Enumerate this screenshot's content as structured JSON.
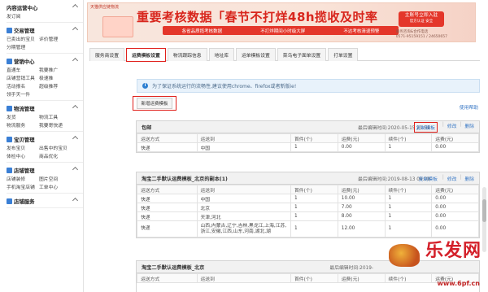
{
  "sidebar": {
    "sections": [
      {
        "title": "内容运营中心",
        "rows": [
          [
            "发订阅"
          ]
        ]
      },
      {
        "title": "交易管理",
        "rows": [
          [
            "已卖出的宝贝",
            "评价管理"
          ],
          [
            "分期管理"
          ]
        ]
      },
      {
        "title": "营销中心",
        "rows": [
          [
            "直通车",
            "我要推广"
          ],
          [
            "店铺营销工具",
            "极速推"
          ],
          [
            "活动报名",
            "超级推荐"
          ],
          [
            "领手天一件"
          ]
        ]
      },
      {
        "title": "物流管理",
        "rows": [
          [
            "发货",
            "物流工具"
          ],
          [
            "物流服务",
            "我要寄快递"
          ]
        ]
      },
      {
        "title": "宝贝管理",
        "rows": [
          [
            "发布宝贝",
            "出售中的宝贝"
          ],
          [
            "体检中心",
            "商品优化"
          ]
        ]
      },
      {
        "title": "店铺管理",
        "rows": [
          [
            "店铺装修",
            "图片空间"
          ],
          [
            "手机淘宝店铺",
            "工单中心"
          ]
        ]
      },
      {
        "title": "店铺服务",
        "rows": []
      }
    ]
  },
  "banner": {
    "tag": "天猫供应链物流",
    "title": "重要考核数据「春节不打烊48h揽收及时率",
    "points": [
      "各省品质揽考核数据",
      "不打烊期间小时级大屏",
      "不达考核清退预警"
    ],
    "cta_line1": "主账号立即入驻",
    "cta_line2": "官方认证 安全",
    "phone_line1": "服务咨询&合作电话",
    "phone_line2": "0571-95159151 / 24650657"
  },
  "tabs": [
    "服务商设置",
    "运费模板设置",
    "物流跟踪信息",
    "地址库",
    "运单模板设置",
    "菜鸟电子面单设置",
    "打单设置"
  ],
  "active_tab": 1,
  "notice": "为了保证系统运行的流畅性,建议使用chrome、firefox或者新版ie!",
  "new_template_label": "新增运费模板",
  "help_link": "使用帮助",
  "columns": [
    "运送方式",
    "运送到",
    "首件(个)",
    "运费(元)",
    "续件(个)",
    "运费(元)"
  ],
  "templates": [
    {
      "name": "包邮",
      "meta": "最后编辑时间:2020-05-15 21:58",
      "actions": [
        "复制模板",
        "修改",
        "删除"
      ],
      "rows": [
        [
          "快递",
          "中国",
          "1",
          "0.00",
          "1",
          "0.00"
        ]
      ]
    },
    {
      "name": "淘宝二手默认运费模板_北京的副本(1)",
      "meta": "最后编辑时间:2019-08-13 09:08",
      "actions": [
        "复制模板",
        "修改",
        "删除"
      ],
      "rows": [
        [
          "快递",
          "中国",
          "1",
          "10.00",
          "1",
          "0.00"
        ],
        [
          "快递",
          "北京",
          "1",
          "7.00",
          "1",
          "0.00"
        ],
        [
          "快递",
          "天津,河北",
          "1",
          "8.00",
          "1",
          "0.00"
        ],
        [
          "快递",
          "山西,内蒙古,辽宁,吉林,黑龙江,上海,江苏,浙江,安徽,江西,山东,河南,湖北,湖",
          "1",
          "12.00",
          "1",
          "0.00"
        ]
      ]
    },
    {
      "name": "淘宝二手默认运费模板_北京",
      "meta": "最后编辑时间:2019-",
      "actions": []
    }
  ],
  "watermark": {
    "text": "乐发网",
    "url": "www.6pf.cn"
  }
}
